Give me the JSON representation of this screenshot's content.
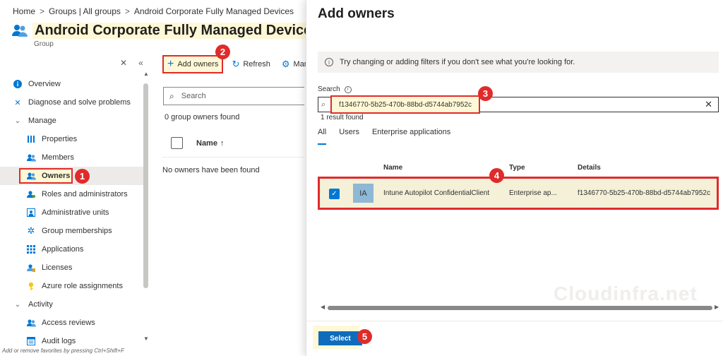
{
  "breadcrumb": [
    "Home",
    "Groups | All groups",
    "Android Corporate Fully Managed Devices"
  ],
  "page": {
    "title": "Android Corporate Fully Managed Devices |",
    "subtitle": "Group",
    "collapse_x": "✕",
    "collapse_chevrons": "«"
  },
  "nav": {
    "overview": "Overview",
    "diagnose": "Diagnose and solve problems",
    "manage": "Manage",
    "properties": "Properties",
    "members": "Members",
    "owners": "Owners",
    "roles": "Roles and administrators",
    "admin_units": "Administrative units",
    "group_memberships": "Group memberships",
    "applications": "Applications",
    "licenses": "Licenses",
    "azure_roles": "Azure role assignments",
    "activity": "Activity",
    "access_reviews": "Access reviews",
    "audit_logs": "Audit logs"
  },
  "footer_hint": "Add or remove favorites by pressing Ctrl+Shift+F",
  "toolbar": {
    "add_owners": "Add owners",
    "refresh": "Refresh",
    "manage": "Mana"
  },
  "owners_blade": {
    "search_placeholder": "Search",
    "count": "0 group owners found",
    "col_name": "Name",
    "sort_arrow": "↑",
    "empty": "No owners have been found"
  },
  "panel": {
    "title": "Add owners",
    "info": "Try changing or adding filters if you don't see what you're looking for.",
    "search_label": "Search",
    "search_value": "f1346770-5b25-470b-88bd-d5744ab7952c",
    "result_count": "1 result found",
    "tabs": [
      "All",
      "Users",
      "Enterprise applications"
    ],
    "columns": {
      "name": "Name",
      "type": "Type",
      "details": "Details"
    },
    "result": {
      "initials": "IA",
      "name": "Intune Autopilot ConfidentialClient",
      "type": "Enterprise ap...",
      "details": "f1346770-5b25-470b-88bd-d5744ab7952c"
    },
    "select_button": "Select"
  },
  "watermark": "Cloudinfra.net",
  "steps": [
    "1",
    "2",
    "3",
    "4",
    "5"
  ],
  "colors": {
    "accent": "#0078d4",
    "highlight_border": "#e02b2b",
    "highlight_fill": "#fff8d6"
  }
}
